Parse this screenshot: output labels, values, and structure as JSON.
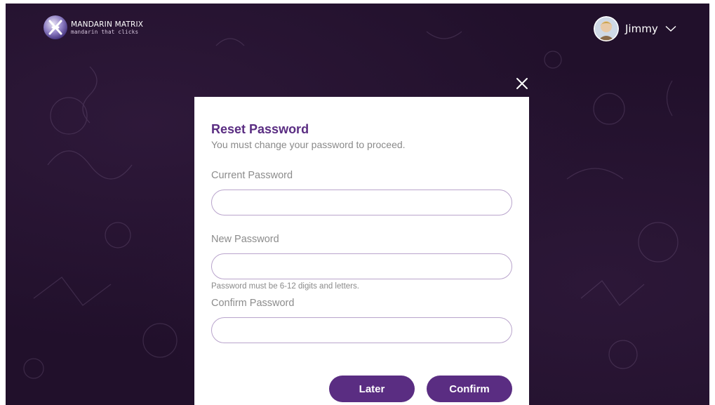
{
  "header": {
    "logo": {
      "title": "MANDARIN MATRIX",
      "tagline": "mandarin that clicks",
      "icon": "mandarin-matrix-logo-icon"
    },
    "user": {
      "name": "Jimmy",
      "avatar_icon": "user-avatar-icon",
      "dropdown_icon": "chevron-down-icon"
    }
  },
  "modal": {
    "close_icon": "close-icon",
    "title": "Reset Password",
    "subtitle": "You must change your password to proceed.",
    "fields": {
      "current": {
        "label": "Current Password",
        "value": "",
        "placeholder": ""
      },
      "new": {
        "label": "New Password",
        "value": "",
        "placeholder": ""
      },
      "confirm": {
        "label": "Confirm Password",
        "value": "",
        "placeholder": ""
      }
    },
    "hint": "Password must be 6-12 digits and letters.",
    "buttons": {
      "later": "Later",
      "confirm": "Confirm"
    }
  },
  "colors": {
    "background": "#21102b",
    "accent": "#5a2d82",
    "input_border": "#b9a4cc",
    "muted_text": "#8a8a8a"
  }
}
